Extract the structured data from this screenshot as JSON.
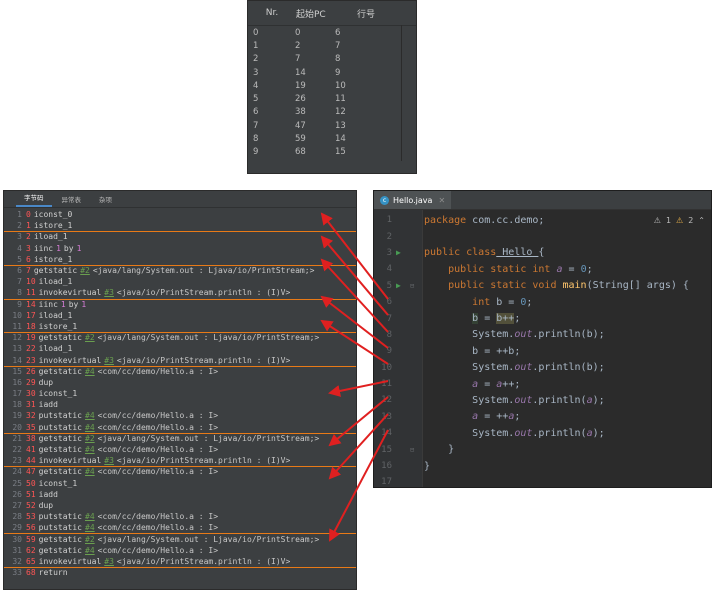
{
  "line_table": {
    "headers": [
      "Nr.",
      "起始PC",
      "行号"
    ],
    "rows": [
      [
        "0",
        "0",
        "6"
      ],
      [
        "1",
        "2",
        "7"
      ],
      [
        "2",
        "7",
        "8"
      ],
      [
        "3",
        "14",
        "9"
      ],
      [
        "4",
        "19",
        "10"
      ],
      [
        "5",
        "26",
        "11"
      ],
      [
        "6",
        "38",
        "12"
      ],
      [
        "7",
        "47",
        "13"
      ],
      [
        "8",
        "59",
        "14"
      ],
      [
        "9",
        "68",
        "15"
      ]
    ]
  },
  "bytecode": {
    "tabs": [
      "字节码",
      "异常表",
      "杂项"
    ],
    "lines": [
      {
        "idx": "1",
        "off": "0",
        "op": "iconst_0"
      },
      {
        "idx": "2",
        "off": "1",
        "op": "istore_1"
      },
      {
        "idx": "3",
        "off": "2",
        "op": "iload_1"
      },
      {
        "idx": "4",
        "off": "3",
        "op": "iinc",
        "ref": "1",
        "extra": "by",
        "num": "1"
      },
      {
        "idx": "5",
        "off": "6",
        "op": "istore_1"
      },
      {
        "idx": "6",
        "off": "7",
        "op": "getstatic",
        "ref": "#2",
        "cmt": "<java/lang/System.out : Ljava/io/PrintStream;>"
      },
      {
        "idx": "7",
        "off": "10",
        "op": "iload_1"
      },
      {
        "idx": "8",
        "off": "11",
        "op": "invokevirtual",
        "ref": "#3",
        "cmt": "<java/io/PrintStream.println : (I)V>"
      },
      {
        "idx": "9",
        "off": "14",
        "op": "iinc",
        "ref": "1",
        "extra": "by",
        "num": "1"
      },
      {
        "idx": "10",
        "off": "17",
        "op": "iload_1"
      },
      {
        "idx": "11",
        "off": "18",
        "op": "istore_1"
      },
      {
        "idx": "12",
        "off": "19",
        "op": "getstatic",
        "ref": "#2",
        "cmt": "<java/lang/System.out : Ljava/io/PrintStream;>"
      },
      {
        "idx": "13",
        "off": "22",
        "op": "iload_1"
      },
      {
        "idx": "14",
        "off": "23",
        "op": "invokevirtual",
        "ref": "#3",
        "cmt": "<java/io/PrintStream.println : (I)V>"
      },
      {
        "idx": "15",
        "off": "26",
        "op": "getstatic",
        "ref": "#4",
        "cmt": "<com/cc/demo/Hello.a : I>"
      },
      {
        "idx": "16",
        "off": "29",
        "op": "dup"
      },
      {
        "idx": "17",
        "off": "30",
        "op": "iconst_1"
      },
      {
        "idx": "18",
        "off": "31",
        "op": "iadd"
      },
      {
        "idx": "19",
        "off": "32",
        "op": "putstatic",
        "ref": "#4",
        "cmt": "<com/cc/demo/Hello.a : I>"
      },
      {
        "idx": "20",
        "off": "35",
        "op": "putstatic",
        "ref": "#4",
        "cmt": "<com/cc/demo/Hello.a : I>"
      },
      {
        "idx": "21",
        "off": "38",
        "op": "getstatic",
        "ref": "#2",
        "cmt": "<java/lang/System.out : Ljava/io/PrintStream;>"
      },
      {
        "idx": "22",
        "off": "41",
        "op": "getstatic",
        "ref": "#4",
        "cmt": "<com/cc/demo/Hello.a : I>"
      },
      {
        "idx": "23",
        "off": "44",
        "op": "invokevirtual",
        "ref": "#3",
        "cmt": "<java/io/PrintStream.println : (I)V>"
      },
      {
        "idx": "24",
        "off": "47",
        "op": "getstatic",
        "ref": "#4",
        "cmt": "<com/cc/demo/Hello.a : I>"
      },
      {
        "idx": "25",
        "off": "50",
        "op": "iconst_1"
      },
      {
        "idx": "26",
        "off": "51",
        "op": "iadd"
      },
      {
        "idx": "27",
        "off": "52",
        "op": "dup"
      },
      {
        "idx": "28",
        "off": "53",
        "op": "putstatic",
        "ref": "#4",
        "cmt": "<com/cc/demo/Hello.a : I>"
      },
      {
        "idx": "29",
        "off": "56",
        "op": "putstatic",
        "ref": "#4",
        "cmt": "<com/cc/demo/Hello.a : I>"
      },
      {
        "idx": "30",
        "off": "59",
        "op": "getstatic",
        "ref": "#2",
        "cmt": "<java/lang/System.out : Ljava/io/PrintStream;>"
      },
      {
        "idx": "31",
        "off": "62",
        "op": "getstatic",
        "ref": "#4",
        "cmt": "<com/cc/demo/Hello.a : I>"
      },
      {
        "idx": "32",
        "off": "65",
        "op": "invokevirtual",
        "ref": "#3",
        "cmt": "<java/io/PrintStream.println : (I)V>"
      },
      {
        "idx": "33",
        "off": "68",
        "op": "return"
      }
    ]
  },
  "editor": {
    "tab_title": "Hello.java",
    "warnings": {
      "weak": "1",
      "warn": "2"
    },
    "line_numbers": [
      "1",
      "2",
      "3",
      "4",
      "5",
      "6",
      "7",
      "8",
      "9",
      "10",
      "11",
      "12",
      "13",
      "14",
      "15",
      "16",
      "17"
    ],
    "code": {
      "l1_kw": "package",
      "l1_rest": " com.cc.demo;",
      "l3_kw": "public class",
      "l3_name": " Hello ",
      "l3_brace": "{",
      "l4_kw": "public static int",
      "l4_field": " a",
      "l4_eq": " = ",
      "l4_num": "0",
      "l4_end": ";",
      "l5_kw": "public static void",
      "l5_method": " main",
      "l5_rest": "(String[] args) {",
      "l6_kw": "int",
      "l6_rest": " b = ",
      "l6_num": "0",
      "l6_end": ";",
      "l7_b": "b",
      "l7_eq": " = ",
      "l7_expr": "b++",
      "l7_end": ";",
      "l8_pre": "System.",
      "l8_out": "out",
      "l8_post": ".println(b);",
      "l9": "b = ++b;",
      "l10_pre": "System.",
      "l10_out": "out",
      "l10_post": ".println(b);",
      "l11_a": "a",
      "l11_eq": " = ",
      "l11_a2": "a",
      "l11_end": "++;",
      "l12_pre": "System.",
      "l12_out": "out",
      "l12_mid": ".println(",
      "l12_a": "a",
      "l12_end": ");",
      "l13_a": "a",
      "l13_eq": " = ++",
      "l13_a2": "a",
      "l13_end": ";",
      "l14_pre": "System.",
      "l14_out": "out",
      "l14_mid": ".println(",
      "l14_a": "a",
      "l14_end": ");",
      "l15": "}",
      "l16": "}"
    }
  },
  "colors": {
    "arrow": "#e02020",
    "separator": "#e87a17",
    "bytecode_offset": "#ff5555",
    "editor_bg": "#2b2b2b",
    "panel_bg": "#3c3f41"
  },
  "icons": [
    "java-class-icon",
    "run-gutter-icon",
    "fold-icon",
    "close-tab-icon",
    "warning-icon"
  ]
}
